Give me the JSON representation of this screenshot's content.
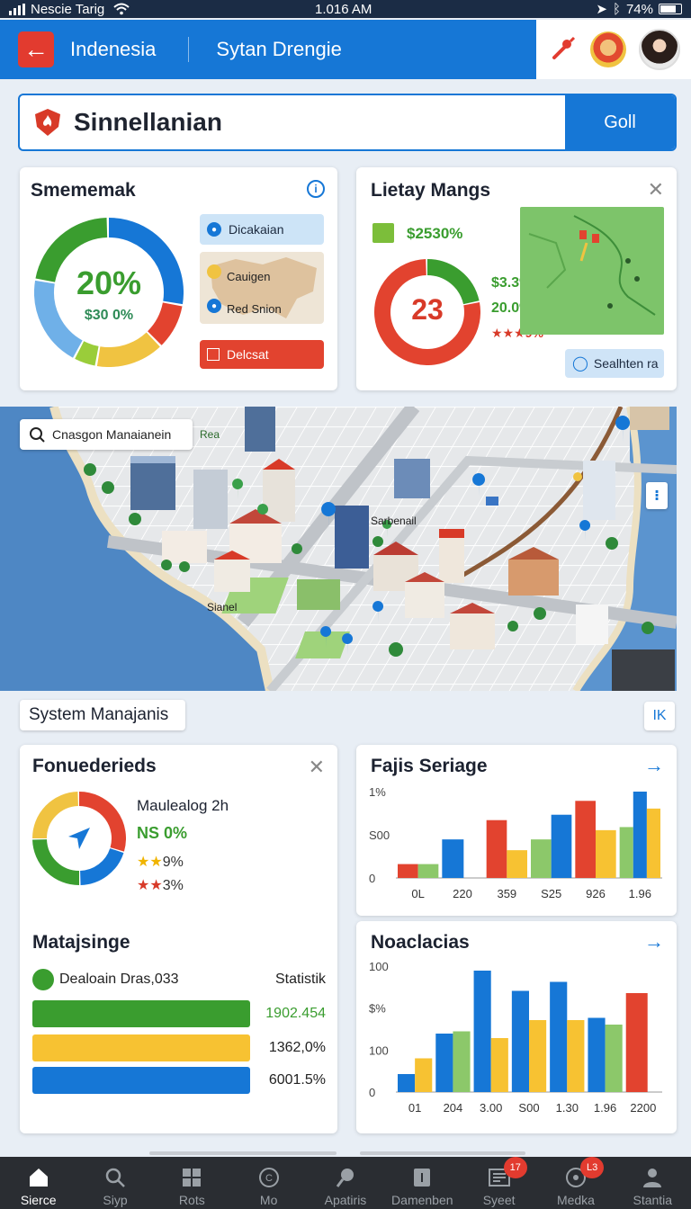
{
  "status_bar": {
    "carrier": "Nescie Tarig",
    "time": "1.016 AM",
    "battery": "74%"
  },
  "header": {
    "crumb1": "Indenesia",
    "crumb2": "Sytan Drengie"
  },
  "search": {
    "value": "Sinnellanian",
    "button": "Goll"
  },
  "card1": {
    "title": "Smememak",
    "donut_value": "20%",
    "donut_sub": "$30 0%",
    "donut_segments": [
      {
        "color": "#1677d6",
        "value": 28
      },
      {
        "color": "#e2432f",
        "value": 10
      },
      {
        "color": "#f0c341",
        "value": 15
      },
      {
        "color": "#9acd3a",
        "value": 5
      },
      {
        "color": "#6fb0e8",
        "value": 20
      },
      {
        "color": "#3a9d2f",
        "value": 22
      }
    ],
    "chip1": "Dicakaian",
    "chip2": "Cauigen",
    "chip3": "Red Snion",
    "chip4": "Delcsat"
  },
  "card2": {
    "title": "Lietay Mangs",
    "headline": "$2530%",
    "donut_value": "23",
    "donut_segments": [
      {
        "color": "#3a9d2f",
        "value": 22
      },
      {
        "color": "#e2432f",
        "value": 78
      }
    ],
    "stat1": "$3.3%",
    "stat2": "20.0%",
    "stat3": "★★★9%",
    "search_button": "Sealhten ra"
  },
  "map": {
    "search_label": "Cnasgon Manaianein",
    "area_label": "Rea",
    "poi1": "Sarbenail",
    "poi2": "Sianel",
    "action": "⁝"
  },
  "section": {
    "label": "System Manajanis",
    "button": "IK"
  },
  "card3": {
    "title": "Fonuederieds",
    "donut_segments": [
      {
        "color": "#e2432f",
        "value": 30
      },
      {
        "color": "#1677d6",
        "value": 20
      },
      {
        "color": "#3a9d2f",
        "value": 25
      },
      {
        "color": "#f0c341",
        "value": 25
      }
    ],
    "line1": "Maulealog 2h",
    "line2": "NS 0%",
    "line3": "9%",
    "line4": "3%",
    "sub_title": "Matajsinge",
    "row_label": "Dealoain Dras,033",
    "row_stat": "Statistik",
    "bars": [
      {
        "color": "#3a9d2f",
        "value": "1902.454",
        "value_color": "#3a9d2f"
      },
      {
        "color": "#f7c232",
        "value": "1362,0%",
        "value_color": "#222"
      },
      {
        "color": "#1677d6",
        "value": "6001.5%",
        "value_color": "#222"
      }
    ]
  },
  "card4": {
    "title": "Fajis Seriage",
    "chart_data": {
      "type": "bar",
      "categories": [
        "0L",
        "220",
        "359",
        "S25",
        "926",
        "1.96"
      ],
      "y_ticks": [
        "1%",
        "S00",
        "0"
      ],
      "series": [
        {
          "color": "#e2432f",
          "values": [
            0.18,
            0,
            0.75,
            0,
            1.0,
            0
          ]
        },
        {
          "color": "#8cc86a",
          "values": [
            0.18,
            0,
            0,
            0.5,
            0,
            0.66
          ]
        },
        {
          "color": "#1677d6",
          "values": [
            0,
            0.5,
            0,
            0.82,
            0,
            1.12
          ]
        },
        {
          "color": "#f7c232",
          "values": [
            0,
            0,
            0.36,
            0,
            0.62,
            0.9
          ]
        }
      ]
    }
  },
  "card5": {
    "title": "Noaclacias",
    "chart_data": {
      "type": "bar",
      "categories": [
        "01",
        "204",
        "3.00",
        "S00",
        "1.30",
        "1.96",
        "2200"
      ],
      "y_ticks": [
        "100",
        "$%",
        "100",
        "0"
      ],
      "series": [
        {
          "color": "#1677d6",
          "values": [
            0.16,
            0.52,
            1.08,
            0.9,
            0.98,
            0.66,
            0
          ]
        },
        {
          "color": "#f7c232",
          "values": [
            0.3,
            0,
            0.48,
            0.64,
            0.64,
            0,
            0
          ]
        },
        {
          "color": "#8cc86a",
          "values": [
            0,
            0.54,
            0,
            0,
            0,
            0.6,
            0
          ]
        },
        {
          "color": "#e2432f",
          "values": [
            0,
            0,
            0,
            0,
            0,
            0,
            0.88
          ]
        }
      ]
    }
  },
  "bottom_nav": [
    {
      "label": "Sierce",
      "icon": "home-icon",
      "active": true
    },
    {
      "label": "Siyp",
      "icon": "search-icon"
    },
    {
      "label": "Rots",
      "icon": "grid-icon"
    },
    {
      "label": "Mo",
      "icon": "copyright-icon"
    },
    {
      "label": "Apatiris",
      "icon": "pin-icon"
    },
    {
      "label": "Damenben",
      "icon": "info-box-icon"
    },
    {
      "label": "Syeet",
      "icon": "newspaper-icon",
      "badge": "17"
    },
    {
      "label": "Medka",
      "icon": "compass-icon",
      "badge": "L3"
    },
    {
      "label": "Stantia",
      "icon": "person-icon"
    }
  ]
}
